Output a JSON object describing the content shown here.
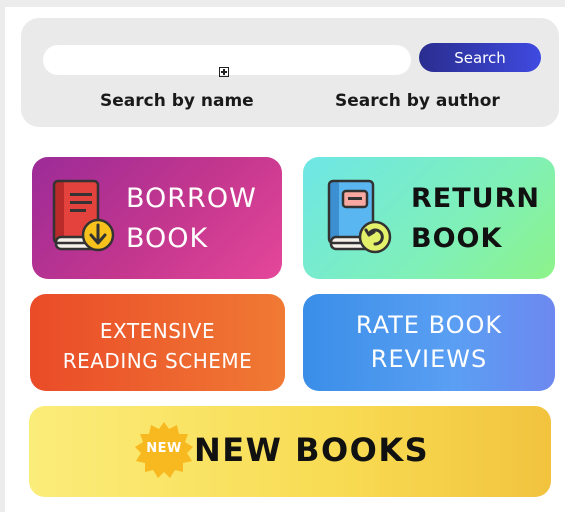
{
  "search": {
    "input_value": "",
    "button_label": "Search",
    "option_name": "Search by name",
    "option_author": "Search by author"
  },
  "tiles": {
    "borrow": {
      "line1": "BORROW",
      "line2": "BOOK",
      "icon": "book-download-icon"
    },
    "return": {
      "line1": "RETURN",
      "line2": "BOOK",
      "icon": "book-return-icon"
    },
    "extensive": {
      "line1": "EXTENSIVE",
      "line2": "READING SCHEME"
    },
    "rate": {
      "line1": "RATE BOOK",
      "line2": "REVIEWS"
    },
    "new_books": {
      "badge": "NEW",
      "label": "NEW BOOKS",
      "icon": "new-badge-icon"
    }
  },
  "colors": {
    "search_button": "#3a40c8",
    "borrow": "#c4378e",
    "return": "#7ff0b8",
    "extensive": "#ee6530",
    "rate": "#5a9ff3",
    "new_books": "#f8db52"
  }
}
